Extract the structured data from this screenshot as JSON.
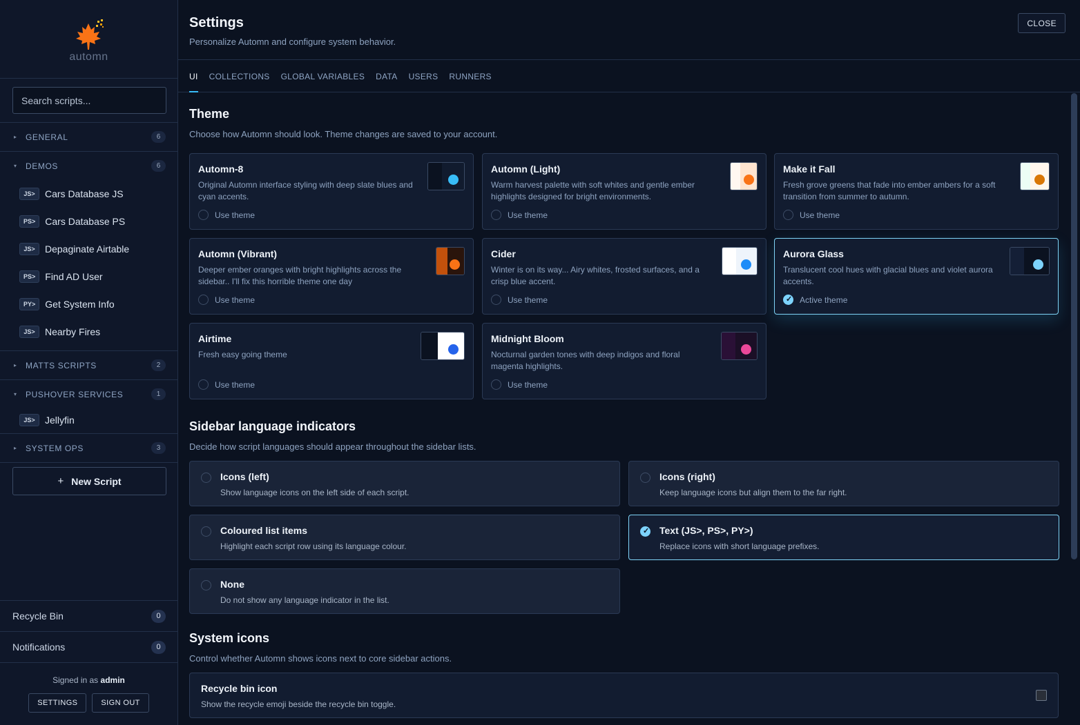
{
  "app": {
    "logo_text": "automn",
    "logo_icon": "maple-leaf-icon"
  },
  "sidebar": {
    "search_placeholder": "Search scripts...",
    "groups": [
      {
        "title": "GENERAL",
        "count": "6",
        "expanded": false
      },
      {
        "title": "DEMOS",
        "count": "6",
        "expanded": true,
        "items": [
          {
            "lang": "JS>",
            "name": "Cars Database JS"
          },
          {
            "lang": "PS>",
            "name": "Cars Database PS"
          },
          {
            "lang": "JS>",
            "name": "Depaginate Airtable"
          },
          {
            "lang": "PS>",
            "name": "Find AD User"
          },
          {
            "lang": "PY>",
            "name": "Get System Info"
          },
          {
            "lang": "JS>",
            "name": "Nearby Fires"
          }
        ]
      },
      {
        "title": "MATTS SCRIPTS",
        "count": "2",
        "expanded": false
      },
      {
        "title": "PUSHOVER SERVICES",
        "count": "1",
        "expanded": true,
        "items": [
          {
            "lang": "JS>",
            "name": "Jellyfin"
          }
        ]
      },
      {
        "title": "SYSTEM OPS",
        "count": "3",
        "expanded": false
      }
    ],
    "new_script_label": "New Script",
    "recycle_bin": {
      "label": "Recycle Bin",
      "count": "0"
    },
    "notifications": {
      "label": "Notifications",
      "count": "0"
    },
    "signed_in_prefix": "Signed in as",
    "signed_in_user": "admin",
    "settings_label": "SETTINGS",
    "sign_out_label": "SIGN OUT"
  },
  "header": {
    "title": "Settings",
    "subtitle": "Personalize Automn and configure system behavior.",
    "close_label": "CLOSE"
  },
  "tabs": [
    "UI",
    "COLLECTIONS",
    "GLOBAL VARIABLES",
    "DATA",
    "USERS",
    "RUNNERS"
  ],
  "active_tab": "UI",
  "theme_section": {
    "title": "Theme",
    "subtitle": "Choose how Automn should look. Theme changes are saved to your account.",
    "use_label": "Use theme",
    "active_label": "Active theme",
    "themes": [
      {
        "name": "Automn-8",
        "desc": "Original Automn interface styling with deep slate blues and cyan accents.",
        "active": false,
        "colors": {
          "left": "#0b1220",
          "right": "#111b2e",
          "dot": "#38bdf8"
        }
      },
      {
        "name": "Automn (Light)",
        "desc": "Warm harvest palette with soft whites and gentle ember highlights designed for bright environments.",
        "active": false,
        "colors": {
          "left": "#fff8f1",
          "right": "#ffe4cf",
          "dot": "#f97316"
        }
      },
      {
        "name": "Make it Fall",
        "desc": "Fresh grove greens that fade into ember ambers for a soft transition from summer to autumn.",
        "active": false,
        "colors": {
          "left": "#ecfdf5",
          "right": "#fff7ed",
          "dot": "#d97706"
        }
      },
      {
        "name": "Automn (Vibrant)",
        "desc": "Deeper ember oranges with bright highlights across the sidebar.. I'll fix this horrible theme one day",
        "active": false,
        "colors": {
          "left": "#c2510c",
          "right": "#2a140b",
          "dot": "#f97316"
        }
      },
      {
        "name": "Cider",
        "desc": "Winter is on its way... Airy whites, frosted surfaces, and a crisp blue accent.",
        "active": false,
        "colors": {
          "left": "#ffffff",
          "right": "#eef4fb",
          "dot": "#1d8cf8"
        }
      },
      {
        "name": "Aurora Glass",
        "desc": "Translucent cool hues with glacial blues and violet aurora accents.",
        "active": true,
        "colors": {
          "left": "#141f36",
          "right": "#0b1220",
          "dot": "#7dd3fc"
        }
      },
      {
        "name": "Airtime",
        "desc": "Fresh easy going theme",
        "active": false,
        "colors": {
          "left": "#0b1220",
          "right": "#ffffff",
          "dot": "#2563eb"
        }
      },
      {
        "name": "Midnight Bloom",
        "desc": "Nocturnal garden tones with deep indigos and floral magenta highlights.",
        "active": false,
        "colors": {
          "left": "#2a1036",
          "right": "#1b0f26",
          "dot": "#ec4899"
        }
      }
    ]
  },
  "language_section": {
    "title": "Sidebar language indicators",
    "subtitle": "Decide how script languages should appear throughout the sidebar lists.",
    "options": [
      {
        "title": "Icons (left)",
        "desc": "Show language icons on the left side of each script.",
        "selected": false
      },
      {
        "title": "Icons (right)",
        "desc": "Keep language icons but align them to the far right.",
        "selected": false
      },
      {
        "title": "Coloured list items",
        "desc": "Highlight each script row using its language colour.",
        "selected": false
      },
      {
        "title": "Text (JS>, PS>, PY>)",
        "desc": "Replace icons with short language prefixes.",
        "selected": true
      },
      {
        "title": "None",
        "desc": "Do not show any language indicator in the list.",
        "selected": false
      }
    ]
  },
  "system_icons_section": {
    "title": "System icons",
    "subtitle": "Control whether Automn shows icons next to core sidebar actions.",
    "recycle": {
      "title": "Recycle bin icon",
      "desc": "Show the recycle emoji beside the recycle bin toggle.",
      "checked": false
    }
  },
  "colors": {
    "accent": "#38bdf8",
    "background": "#0b1220",
    "panel": "#0f1729",
    "brand_orange": "#f97316"
  }
}
